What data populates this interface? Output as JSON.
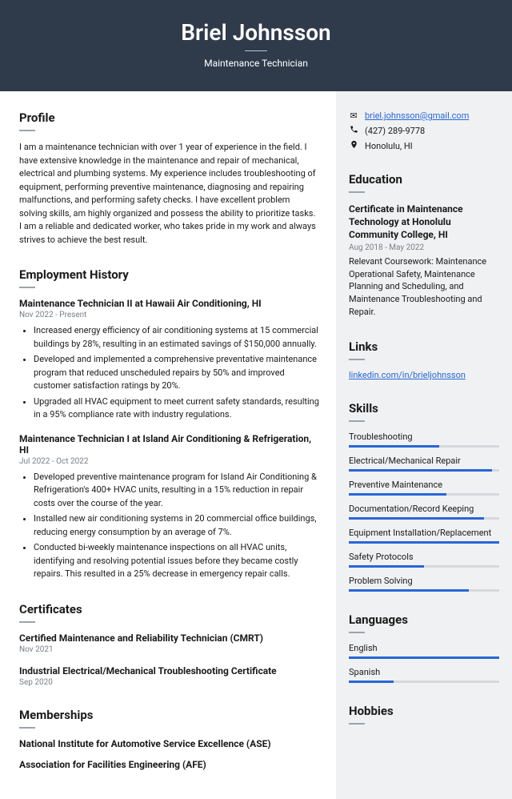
{
  "header": {
    "name": "Briel Johnsson",
    "title": "Maintenance Technician"
  },
  "contact": {
    "email": "briel.johnsson@gmail.com",
    "phone": "(427) 289-9778",
    "location": "Honolulu, HI"
  },
  "profile": {
    "heading": "Profile",
    "text": "I am a maintenance technician with over 1 year of experience in the field. I have extensive knowledge in the maintenance and repair of mechanical, electrical and plumbing systems. My experience includes troubleshooting of equipment, performing preventive maintenance, diagnosing and repairing malfunctions, and performing safety checks. I have excellent problem solving skills, am highly organized and possess the ability to prioritize tasks. I am a reliable and dedicated worker, who takes pride in my work and always strives to achieve the best result."
  },
  "employment": {
    "heading": "Employment History",
    "jobs": [
      {
        "title": "Maintenance Technician II at Hawaii Air Conditioning, HI",
        "dates": "Nov 2022 - Present",
        "bullets": [
          "Increased energy efficiency of air conditioning systems at 15 commercial buildings by 28%, resulting in an estimated savings of $150,000 annually.",
          "Developed and implemented a comprehensive preventative maintenance program that reduced unscheduled repairs by 50% and improved customer satisfaction ratings by 20%.",
          "Upgraded all HVAC equipment to meet current safety standards, resulting in a 95% compliance rate with industry regulations."
        ]
      },
      {
        "title": "Maintenance Technician I at Island Air Conditioning & Refrigeration, HI",
        "dates": "Jul 2022 - Oct 2022",
        "bullets": [
          "Developed preventive maintenance program for Island Air Conditioning & Refrigeration's 400+ HVAC units, resulting in a 15% reduction in repair costs over the course of the year.",
          "Installed new air conditioning systems in 20 commercial office buildings, reducing energy consumption by an average of 7%.",
          "Conducted bi-weekly maintenance inspections on all HVAC units, identifying and resolving potential issues before they became costly repairs. This resulted in a 25% decrease in emergency repair calls."
        ]
      }
    ]
  },
  "certificates": {
    "heading": "Certificates",
    "items": [
      {
        "title": "Certified Maintenance and Reliability Technician (CMRT)",
        "date": "Nov 2021"
      },
      {
        "title": "Industrial Electrical/Mechanical Troubleshooting Certificate",
        "date": "Sep 2020"
      }
    ]
  },
  "memberships": {
    "heading": "Memberships",
    "items": [
      "National Institute for Automotive Service Excellence (ASE)",
      "Association for Facilities Engineering (AFE)"
    ]
  },
  "education": {
    "heading": "Education",
    "title": "Certificate in Maintenance Technology at Honolulu Community College, HI",
    "dates": "Aug 2018 - May 2022",
    "desc": "Relevant Coursework: Maintenance Operational Safety, Maintenance Planning and Scheduling, and Maintenance Troubleshooting and Repair."
  },
  "links": {
    "heading": "Links",
    "link": "linkedin.com/in/brieljohnsson"
  },
  "skills": {
    "heading": "Skills",
    "items": [
      {
        "name": "Troubleshooting",
        "level": 60
      },
      {
        "name": "Electrical/Mechanical Repair",
        "level": 95
      },
      {
        "name": "Preventive Maintenance",
        "level": 65
      },
      {
        "name": "Documentation/Record Keeping",
        "level": 90
      },
      {
        "name": "Equipment Installation/Replacement",
        "level": 100
      },
      {
        "name": "Safety Protocols",
        "level": 50
      },
      {
        "name": "Problem Solving",
        "level": 80
      }
    ]
  },
  "languages": {
    "heading": "Languages",
    "items": [
      {
        "name": "English",
        "level": 100
      },
      {
        "name": "Spanish",
        "level": 30
      }
    ]
  },
  "hobbies": {
    "heading": "Hobbies"
  }
}
